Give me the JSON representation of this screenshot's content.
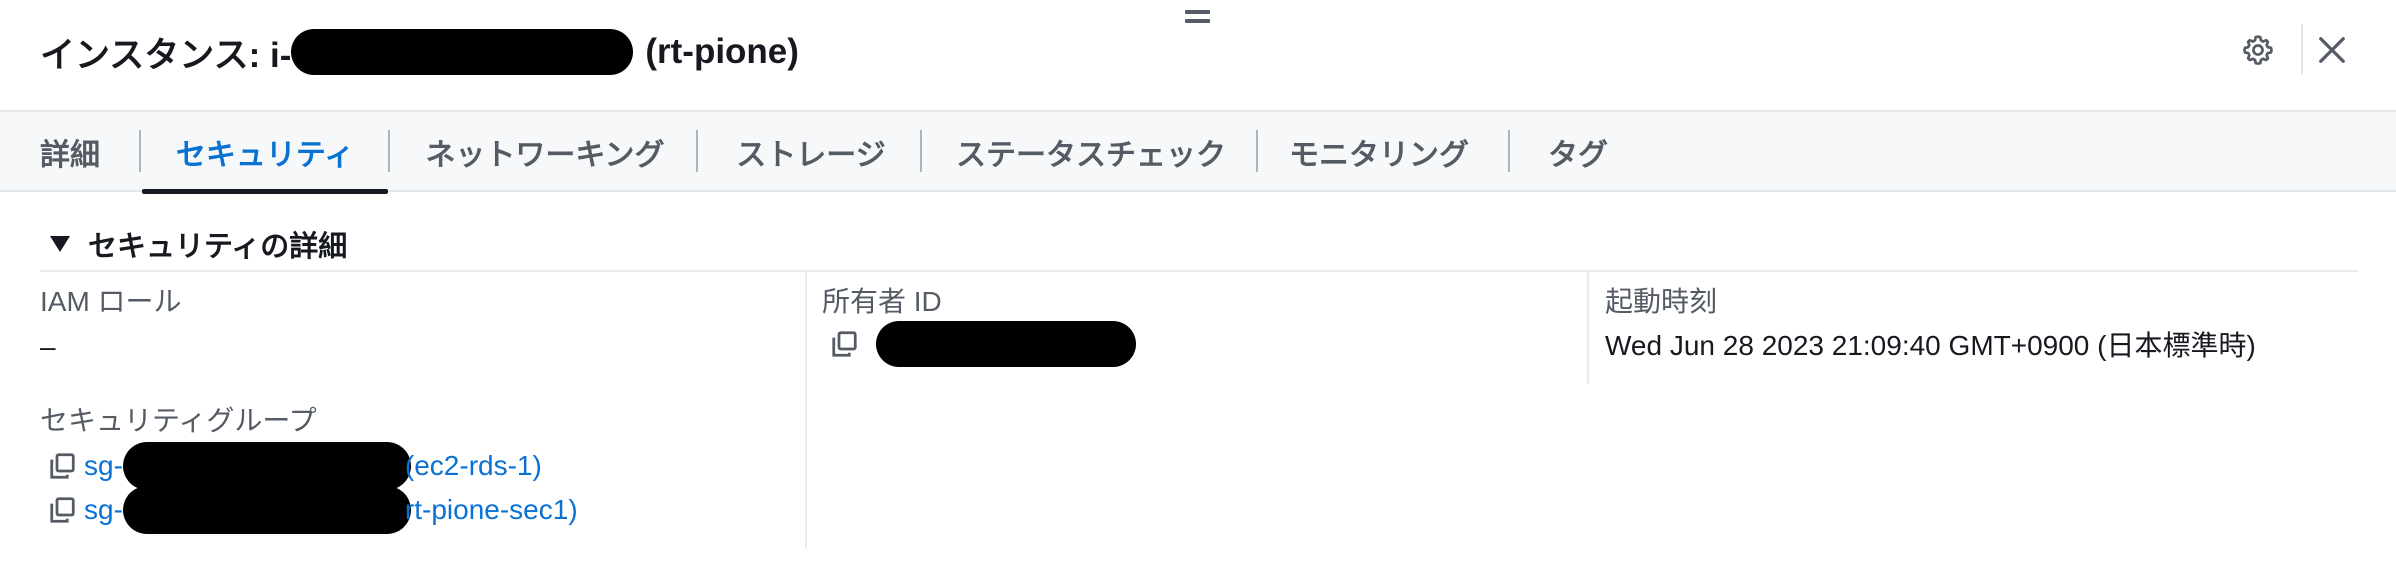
{
  "header": {
    "title_prefix": "インスタンス: i-",
    "title_suffix": "(rt-pione)"
  },
  "tabs": [
    {
      "label": "詳細",
      "active": false
    },
    {
      "label": "セキュリティ",
      "active": true
    },
    {
      "label": "ネットワーキング",
      "active": false
    },
    {
      "label": "ストレージ",
      "active": false
    },
    {
      "label": "ステータスチェック",
      "active": false
    },
    {
      "label": "モニタリング",
      "active": false
    },
    {
      "label": "タグ",
      "active": false
    }
  ],
  "security": {
    "section_title": "セキュリティの詳細",
    "iam_role_label": "IAM ロール",
    "iam_role_value": "–",
    "owner_id_label": "所有者 ID",
    "launch_time_label": "起動時刻",
    "launch_time_value": "Wed Jun 28 2023 21:09:40 GMT+0900 (日本標準時)",
    "security_groups_label": "セキュリティグループ",
    "security_groups": [
      {
        "prefix": "sg-",
        "name": "(ec2-rds-1)"
      },
      {
        "prefix": "sg-",
        "name": "rt-pione-sec1)"
      }
    ]
  },
  "colors": {
    "accent": "#0972d3",
    "text": "#16191f",
    "secondary_text": "#545b64",
    "tabbar_bg": "#f7f8f9"
  },
  "icons": [
    "drag-handle-icon",
    "gear-icon",
    "close-icon",
    "copy-icon",
    "caret-down-icon"
  ]
}
